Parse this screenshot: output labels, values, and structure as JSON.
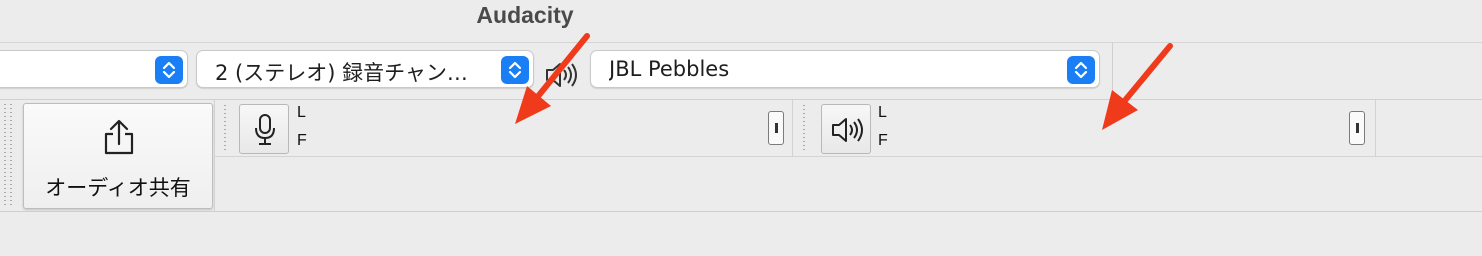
{
  "window": {
    "title": "Audacity"
  },
  "device_toolbar": {
    "host_combo_value": "",
    "channels_combo_value": "2 (ステレオ) 録音チャン…",
    "playback_device_value": "JBL Pebbles",
    "playback_icon": "speaker-icon"
  },
  "share_audio": {
    "label": "オーディオ共有",
    "icon": "share-icon"
  },
  "recording_meter": {
    "icon": "microphone-icon",
    "channel_top": "L",
    "channel_bottom": "F"
  },
  "playback_meter": {
    "icon": "speaker-icon",
    "channel_top": "L",
    "channel_bottom": "F"
  },
  "annotations": {
    "arrow_color": "#f03a1c",
    "count": 2
  },
  "colors": {
    "accent": "#1a7ef5",
    "background": "#ececec"
  }
}
